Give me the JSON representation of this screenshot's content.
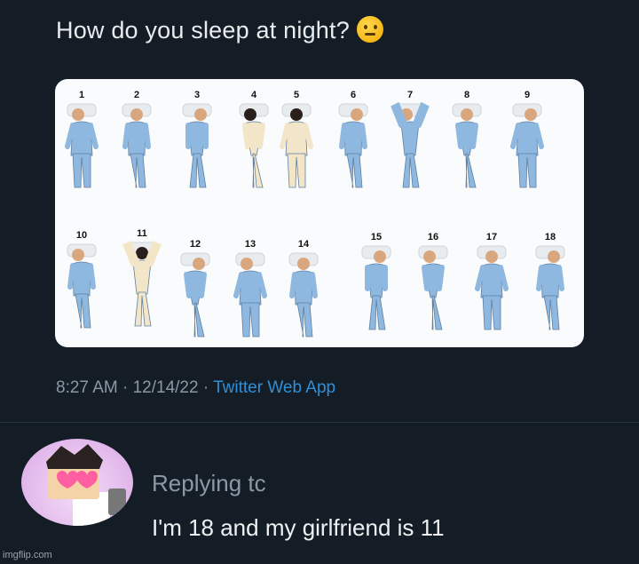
{
  "tweet": {
    "text": "How do you sleep at night?",
    "emoji_icon": "thinking-face-icon",
    "timestamp": "8:27 AM · 12/14/22 ·",
    "source": "Twitter Web App"
  },
  "image": {
    "row1_numbers": [
      "1",
      "2",
      "3",
      "4",
      "5",
      "6",
      "7",
      "8",
      "9"
    ],
    "row2_numbers": [
      "10",
      "11",
      "12",
      "13",
      "14",
      "15",
      "16",
      "17",
      "18"
    ]
  },
  "reply": {
    "replying_to": "Replying tc",
    "text": "I'm 18 and my girlfriend is 11",
    "avatar_icon": "roblox-avatar-icon"
  },
  "watermark": "imgflip.com",
  "colors": {
    "background": "#141d26",
    "pajama_blue": "#8fb8e0",
    "link_blue": "#2f8fd8",
    "muted_text": "#8b98a5"
  }
}
